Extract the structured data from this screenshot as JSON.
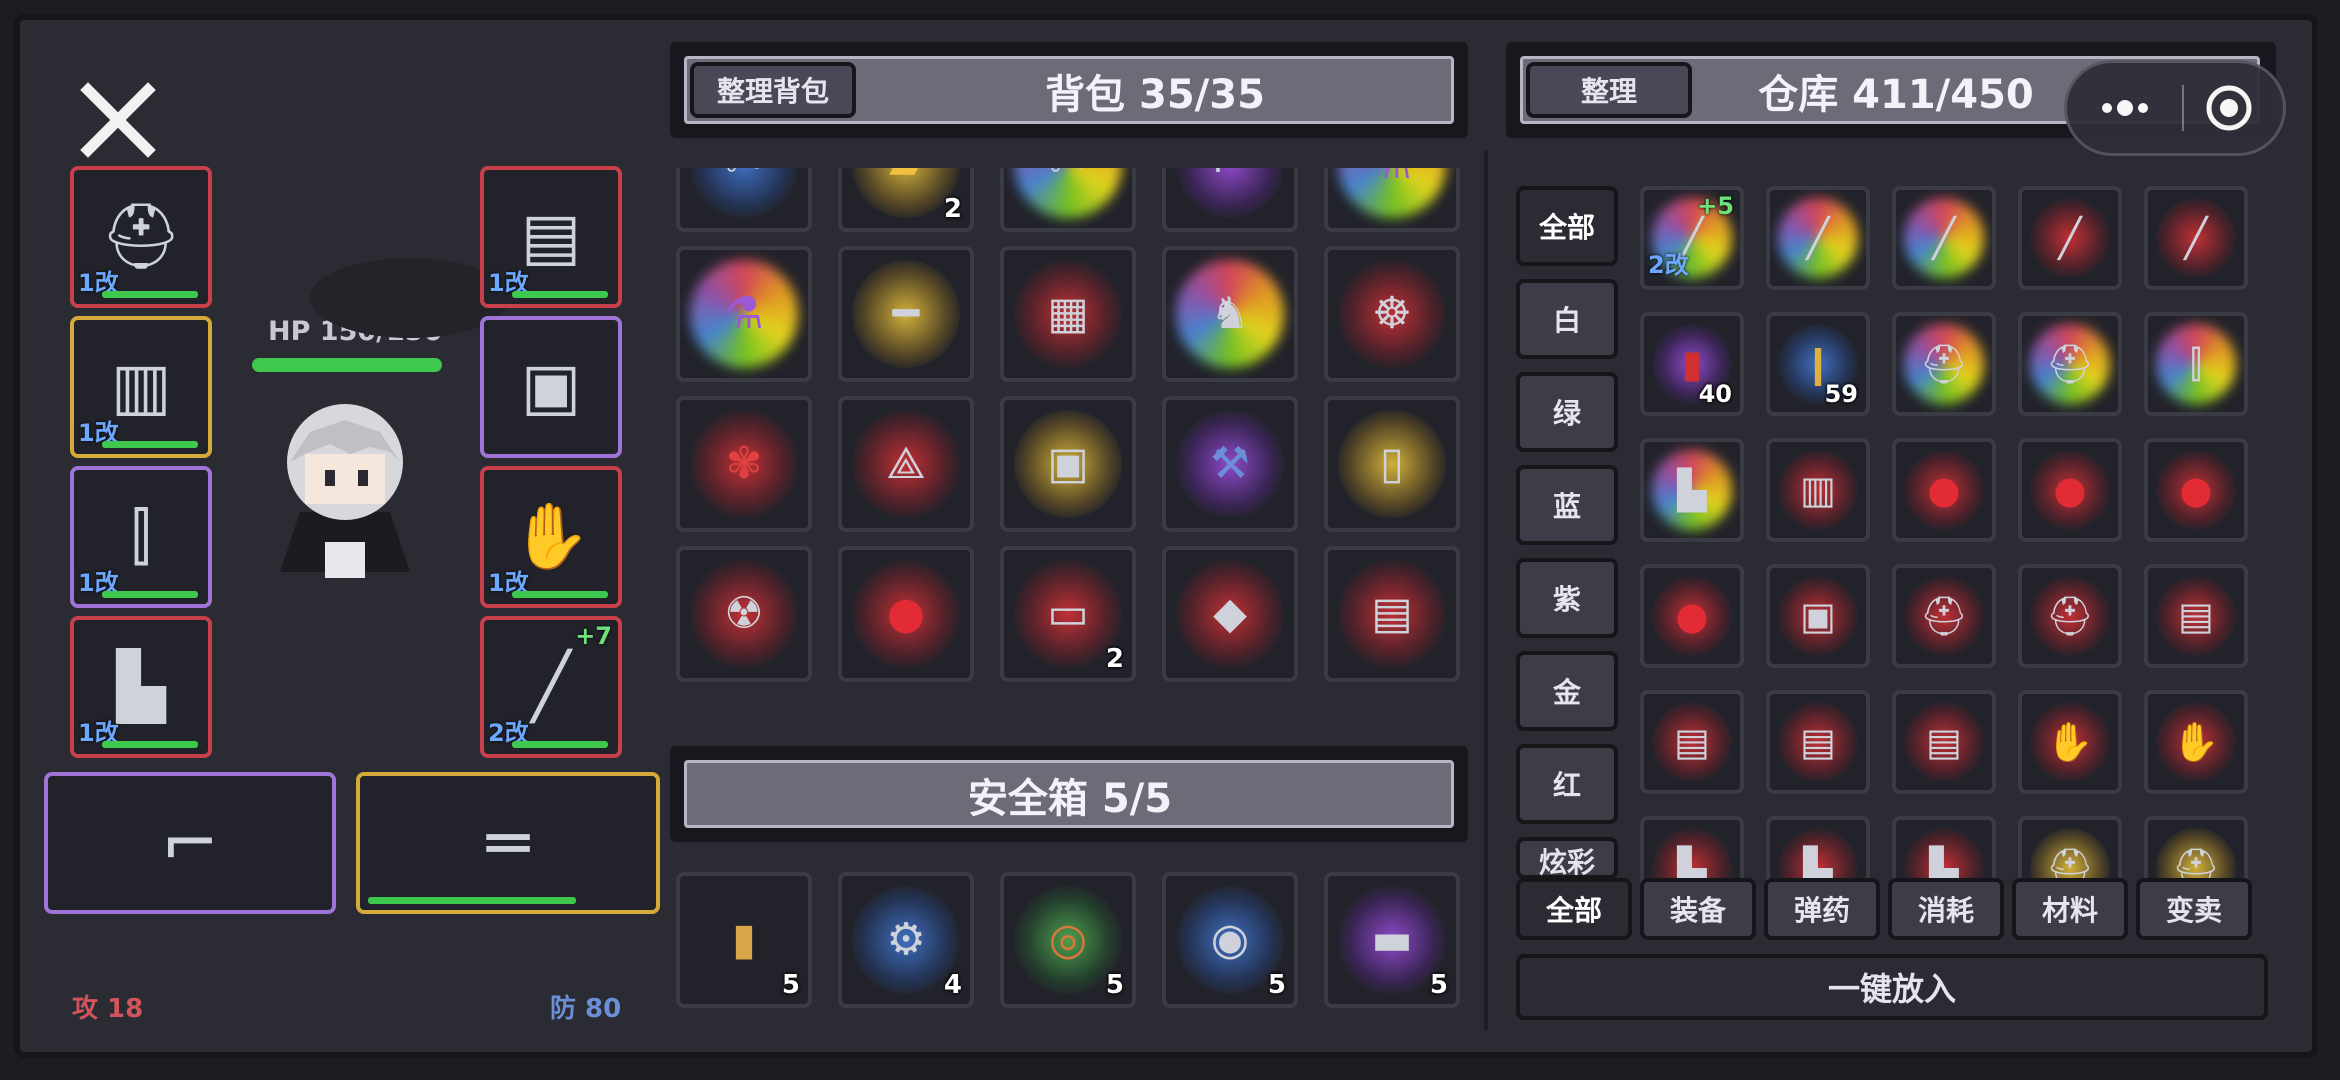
{
  "character": {
    "hp_label": "HP 150/150",
    "hp_fraction": 1.0,
    "attack_label": "攻 18",
    "defense_label": "防 80",
    "close_icon": "close-icon",
    "equip_left": [
      {
        "icon": "helmet-icon",
        "mod": "1改",
        "rarity": "red"
      },
      {
        "icon": "vest-icon",
        "mod": "1改",
        "rarity": "gold"
      },
      {
        "icon": "pants-icon",
        "mod": "1改",
        "rarity": "purple"
      },
      {
        "icon": "boots-icon",
        "mod": "1改",
        "rarity": "red"
      }
    ],
    "equip_right": [
      {
        "icon": "armor-icon",
        "mod": "1改",
        "rarity": "red"
      },
      {
        "icon": "backpack-icon",
        "mod": "",
        "rarity": "purple"
      },
      {
        "icon": "gloves-icon",
        "mod": "1改",
        "rarity": "red"
      },
      {
        "icon": "melee-weapon-icon",
        "mod": "2改",
        "plus": "+7",
        "rarity": "red"
      }
    ],
    "weapons": [
      {
        "icon": "smg-icon",
        "rarity": "purple"
      },
      {
        "icon": "shotgun-icon",
        "rarity": "gold"
      }
    ]
  },
  "backpack": {
    "sort_button": "整理背包",
    "title": "背包 35/35",
    "rows": [
      [
        {
          "icon": "tools-icon",
          "glow": "blue",
          "count": ""
        },
        {
          "icon": "gold-bar-icon",
          "glow": "gold",
          "count": "2"
        },
        {
          "icon": "tools-icon",
          "glow": "rainbow",
          "count": ""
        },
        {
          "icon": "gun-icon",
          "glow": "purple",
          "count": ""
        },
        {
          "icon": "potion-icon",
          "glow": "rainbow",
          "count": ""
        }
      ],
      [
        {
          "icon": "potion-icon",
          "glow": "rainbow",
          "count": ""
        },
        {
          "icon": "sniper-rifle-icon",
          "glow": "gold",
          "count": ""
        },
        {
          "icon": "circuit-board-icon",
          "glow": "red",
          "count": ""
        },
        {
          "icon": "winged-figure-icon",
          "glow": "rainbow",
          "count": ""
        },
        {
          "icon": "sextant-icon",
          "glow": "red",
          "count": ""
        }
      ],
      [
        {
          "icon": "coral-icon",
          "glow": "red",
          "count": ""
        },
        {
          "icon": "compass-icon",
          "glow": "red",
          "count": ""
        },
        {
          "icon": "backpack-icon",
          "glow": "gold",
          "count": ""
        },
        {
          "icon": "axe-icon",
          "glow": "purple",
          "count": ""
        },
        {
          "icon": "analyzer-icon",
          "glow": "gold",
          "count": ""
        }
      ],
      [
        {
          "icon": "radiation-case-icon",
          "glow": "red",
          "count": ""
        },
        {
          "icon": "balloon-icon",
          "glow": "red",
          "count": ""
        },
        {
          "icon": "food-box-icon",
          "glow": "red",
          "count": "2"
        },
        {
          "icon": "hard-drive-icon",
          "glow": "red",
          "count": ""
        },
        {
          "icon": "document-icon",
          "glow": "red",
          "count": ""
        }
      ]
    ]
  },
  "safebox": {
    "title": "安全箱 5/5",
    "items": [
      {
        "icon": "shell-casing-icon",
        "glow": "none",
        "count": "5"
      },
      {
        "icon": "gear-icon",
        "glow": "blue",
        "count": "4"
      },
      {
        "icon": "copper-wire-icon",
        "glow": "green",
        "count": "5"
      },
      {
        "icon": "bearing-icon",
        "glow": "blue",
        "count": "5"
      },
      {
        "icon": "battery-icon",
        "glow": "purple",
        "count": "5"
      }
    ]
  },
  "warehouse": {
    "sort_button": "整理",
    "title": "仓库 411/450",
    "rarity_filters": [
      "全部",
      "白",
      "绿",
      "蓝",
      "紫",
      "金",
      "红",
      "炫彩"
    ],
    "category_tabs": [
      "全部",
      "装备",
      "弹药",
      "消耗",
      "材料",
      "变卖"
    ],
    "put_all_button": "一键放入",
    "rows": [
      [
        {
          "icon": "sword-icon",
          "glow": "rainbow",
          "count": "",
          "mod": "2改",
          "plus": "+5"
        },
        {
          "icon": "sword-icon",
          "glow": "rainbow",
          "count": ""
        },
        {
          "icon": "sword-icon",
          "glow": "rainbow",
          "count": ""
        },
        {
          "icon": "sword-icon",
          "glow": "red",
          "count": ""
        },
        {
          "icon": "sword-icon",
          "glow": "red",
          "count": ""
        }
      ],
      [
        {
          "icon": "shotgun-shell-icon",
          "glow": "purple",
          "count": "40"
        },
        {
          "icon": "bullet-icon",
          "glow": "blue",
          "count": "59"
        },
        {
          "icon": "helmet-icon",
          "glow": "rainbow",
          "count": ""
        },
        {
          "icon": "helmet-icon",
          "glow": "rainbow",
          "count": ""
        },
        {
          "icon": "pants-icon",
          "glow": "rainbow",
          "count": ""
        }
      ],
      [
        {
          "icon": "boots-icon",
          "glow": "rainbow",
          "count": ""
        },
        {
          "icon": "vest-icon",
          "glow": "red",
          "count": ""
        },
        {
          "icon": "balloon-icon",
          "glow": "red",
          "count": ""
        },
        {
          "icon": "balloon-icon",
          "glow": "red",
          "count": ""
        },
        {
          "icon": "balloon-icon",
          "glow": "red",
          "count": ""
        }
      ],
      [
        {
          "icon": "balloon-icon",
          "glow": "red",
          "count": ""
        },
        {
          "icon": "backpack-icon",
          "glow": "red",
          "count": ""
        },
        {
          "icon": "helmet-icon",
          "glow": "red",
          "count": ""
        },
        {
          "icon": "helmet-icon",
          "glow": "red",
          "count": ""
        },
        {
          "icon": "armor-icon",
          "glow": "red",
          "count": ""
        }
      ],
      [
        {
          "icon": "armor-icon",
          "glow": "red",
          "count": ""
        },
        {
          "icon": "armor-icon",
          "glow": "red",
          "count": ""
        },
        {
          "icon": "armor-icon",
          "glow": "red",
          "count": ""
        },
        {
          "icon": "gloves-icon",
          "glow": "red",
          "count": ""
        },
        {
          "icon": "gloves-icon",
          "glow": "red",
          "count": ""
        }
      ],
      [
        {
          "icon": "boots-icon",
          "glow": "red",
          "count": ""
        },
        {
          "icon": "boots-icon",
          "glow": "red",
          "count": ""
        },
        {
          "icon": "boots-icon",
          "glow": "red",
          "count": ""
        },
        {
          "icon": "helmet-icon",
          "glow": "gold",
          "count": ""
        },
        {
          "icon": "helmet-icon",
          "glow": "gold",
          "count": ""
        }
      ]
    ]
  },
  "system_buttons": {
    "more_icon": "more-icon",
    "record_icon": "record-icon"
  },
  "colors": {
    "red": "#c8404b",
    "gold": "#d5a93a",
    "purple": "#a073d6",
    "hp_green": "#3ec94e",
    "mod_blue": "#6da8ff",
    "plus_green": "#6fe07a",
    "attack": "#d0555c",
    "defense": "#6b8fd6"
  }
}
